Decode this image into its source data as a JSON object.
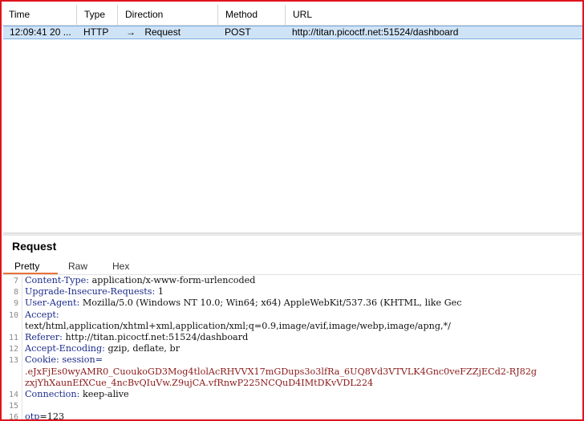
{
  "history": {
    "columns": [
      "Time",
      "Type",
      "Direction",
      "Method",
      "URL"
    ],
    "rows": [
      {
        "time": "12:09:41 20 ...",
        "type": "HTTP",
        "direction_arrow": "→",
        "direction": "Request",
        "method": "POST",
        "url": "http://titan.picoctf.net:51524/dashboard"
      }
    ]
  },
  "request": {
    "title": "Request",
    "tabs": [
      "Pretty",
      "Raw",
      "Hex"
    ],
    "active_tab": "Pretty",
    "lines": [
      {
        "num": "7",
        "name": "Content-Type:",
        "value": " application/x-www-form-urlencoded"
      },
      {
        "num": "8",
        "name": "Upgrade-Insecure-Requests:",
        "value": " 1"
      },
      {
        "num": "9",
        "name": "User-Agent:",
        "value": " Mozilla/5.0 (Windows NT 10.0; Win64; x64) AppleWebKit/537.36 (KHTML, like Gec"
      },
      {
        "num": "10",
        "name": "Accept:",
        "value": ""
      },
      {
        "num": "",
        "name": "",
        "value": "text/html,application/xhtml+xml,application/xml;q=0.9,image/avif,image/webp,image/apng,*/"
      },
      {
        "num": "11",
        "name": "Referer:",
        "value": " http://titan.picoctf.net:51524/dashboard"
      },
      {
        "num": "12",
        "name": "Accept-Encoding:",
        "value": " gzip, deflate, br"
      },
      {
        "num": "13",
        "name": "Cookie:",
        "value": " session="
      },
      {
        "num": "",
        "name": "",
        "cookie": ".eJxFjEs0wyAMR0_CuoukoGD3Mog4tlolAcRHVVX17mGDups3o3lfRa_6UQ8Vd3VTVLK4Gnc0veFZZjECd2-RJ82g"
      },
      {
        "num": "",
        "name": "",
        "cookie": "zxjYhXaunEfXCue_4ncBvQIuVw.Z9ujCA.vfRnwP225NCQuD4IMtDKvVDL224"
      },
      {
        "num": "14",
        "name": "Connection:",
        "value": " keep-alive"
      },
      {
        "num": "15",
        "name": "",
        "value": ""
      },
      {
        "num": "16",
        "param": "otp",
        "value": "=123"
      }
    ]
  }
}
